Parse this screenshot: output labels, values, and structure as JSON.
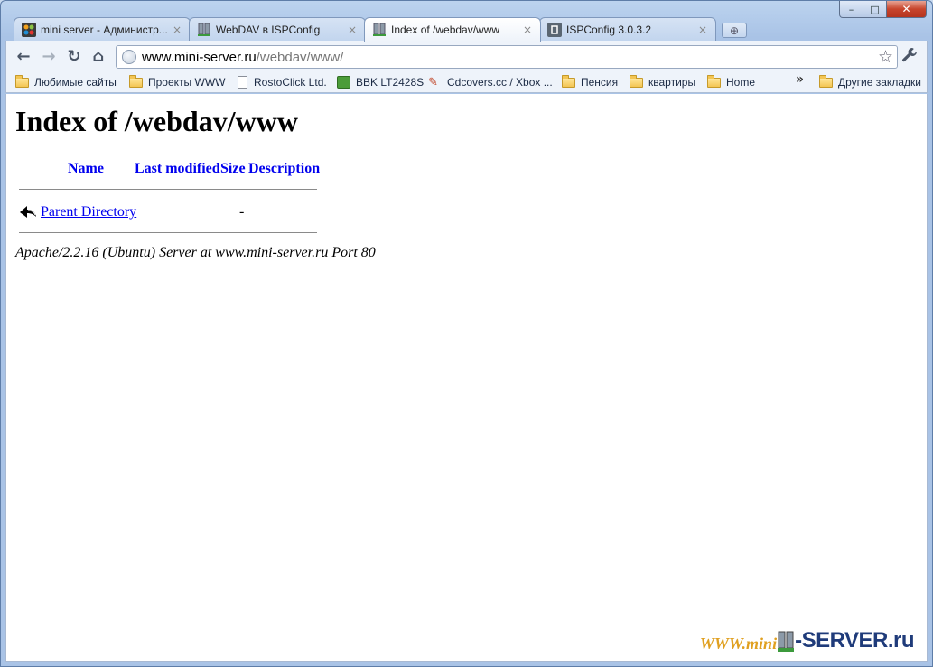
{
  "window": {
    "controls": {
      "minimize": "–",
      "maximize": "□",
      "close": "✕"
    }
  },
  "tabs": [
    {
      "title": "mini server - Администр...",
      "icon": "joomla-icon",
      "close": "×",
      "active": false
    },
    {
      "title": "WebDAV в ISPConfig",
      "icon": "server-icon",
      "close": "×",
      "active": false
    },
    {
      "title": "Index of /webdav/www",
      "icon": "server-icon",
      "close": "×",
      "active": true
    },
    {
      "title": "ISPConfig 3.0.3.2",
      "icon": "ispconfig-icon",
      "close": "×",
      "active": false
    }
  ],
  "toolbar": {
    "url_host": "www.mini-server.ru",
    "url_path": "/webdav/www/",
    "back": "←",
    "forward": "→",
    "reload": "↻",
    "home": "⌂",
    "star": "☆",
    "wrench": "🔧"
  },
  "bookmarks": {
    "items": [
      {
        "label": "Любимые сайты",
        "icon": "folder-icon"
      },
      {
        "label": "Проекты WWW",
        "icon": "folder-icon"
      },
      {
        "label": "RostoClick Ltd.",
        "icon": "page-icon"
      },
      {
        "label": "BBK LT2428S",
        "icon": "bbk-icon"
      },
      {
        "label": "Cdcovers.cc / Xbox ...",
        "icon": "cdcovers-icon"
      },
      {
        "label": "Пенсия",
        "icon": "folder-icon"
      },
      {
        "label": "квартиры",
        "icon": "folder-icon"
      },
      {
        "label": "Home",
        "icon": "folder-icon"
      }
    ],
    "overflow": "»",
    "other": "Другие закладки"
  },
  "page": {
    "title": "Index of /webdav/www",
    "columns": [
      "Name",
      "Last modified",
      "Size",
      "Description"
    ],
    "rows": [
      {
        "name": "Parent Directory",
        "modified": "",
        "size": "-",
        "description": ""
      }
    ],
    "footer": "Apache/2.2.16 (Ubuntu) Server at www.mini-server.ru Port 80"
  },
  "watermark": {
    "left": "WWW.mini",
    "right": "-SERVER.ru"
  }
}
